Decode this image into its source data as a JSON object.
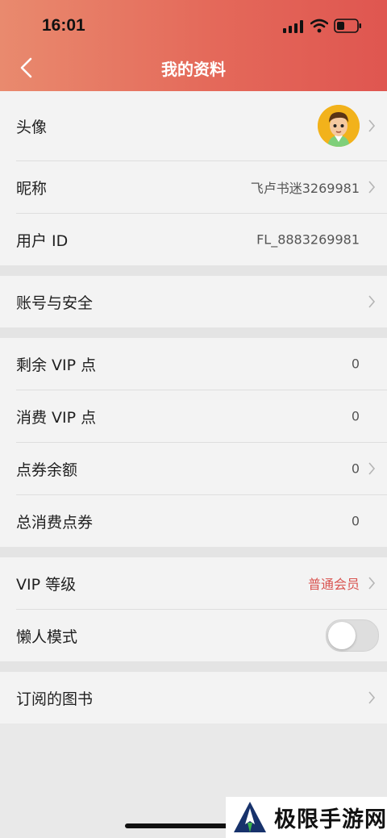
{
  "status_bar": {
    "time": "16:01"
  },
  "header": {
    "title": "我的资料"
  },
  "rows": {
    "avatar": {
      "label": "头像"
    },
    "nickname": {
      "label": "昵称",
      "value": "飞卢书迷3269981"
    },
    "user_id": {
      "label": "用户 ID",
      "value": "FL_8883269981"
    },
    "account_security": {
      "label": "账号与安全"
    },
    "remaining_vip": {
      "label": "剩余 VIP 点",
      "value": "0"
    },
    "consumed_vip": {
      "label": "消费 VIP 点",
      "value": "0"
    },
    "coupon_balance": {
      "label": "点券余额",
      "value": "0"
    },
    "total_coupons_spent": {
      "label": "总消费点券",
      "value": "0"
    },
    "vip_level": {
      "label": "VIP 等级",
      "value": "普通会员"
    },
    "lazy_mode": {
      "label": "懒人模式",
      "enabled": false
    },
    "subscribed_books": {
      "label": "订阅的图书"
    }
  },
  "watermark": {
    "text": "极限手游网"
  },
  "colors": {
    "header_start": "#e98a6e",
    "header_end": "#df5650",
    "vip_value": "#d9534f"
  }
}
